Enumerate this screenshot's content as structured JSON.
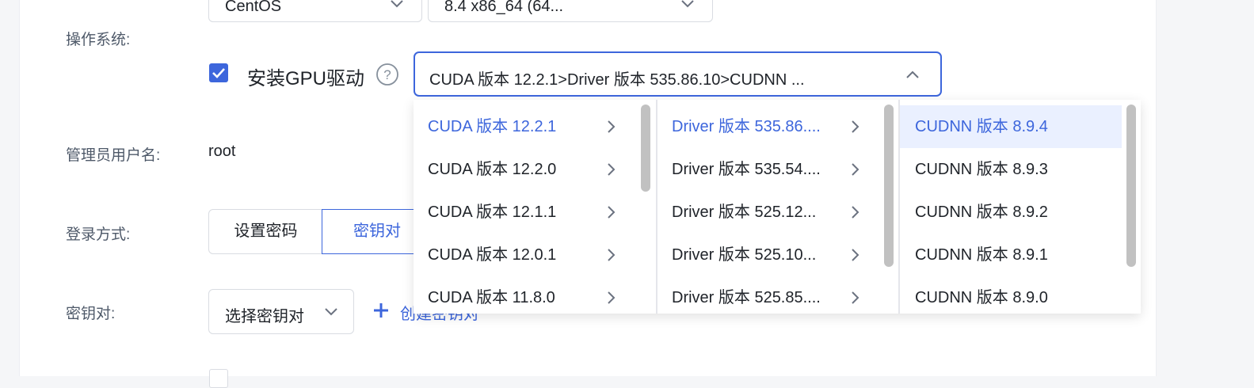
{
  "form": {
    "os_label": "操作系统:",
    "os_select": "CentOS",
    "os_version_select": "8.4 x86_64 (64...",
    "gpu_checkbox_checked": true,
    "gpu_label": "安装GPU驱动",
    "gpu_select_value": "CUDA 版本 12.2.1>Driver 版本 535.86.10>CUDNN ...",
    "admin_label": "管理员用户名:",
    "admin_value": "root",
    "login_label": "登录方式:",
    "login_option_password": "设置密码",
    "login_option_keypair": "密钥对",
    "keypair_label": "密钥对:",
    "keypair_select": "选择密钥对",
    "create_keypair": "创建密钥对"
  },
  "cascader": {
    "cuda_options": [
      "CUDA 版本 12.2.1",
      "CUDA 版本 12.2.0",
      "CUDA 版本 12.1.1",
      "CUDA 版本 12.0.1",
      "CUDA 版本 11.8.0"
    ],
    "driver_options": [
      "Driver 版本 535.86....",
      "Driver 版本 535.54....",
      "Driver 版本 525.12...",
      "Driver 版本 525.10...",
      "Driver 版本 525.85...."
    ],
    "cudnn_options": [
      "CUDNN 版本 8.9.4",
      "CUDNN 版本 8.9.3",
      "CUDNN 版本 8.9.2",
      "CUDNN 版本 8.9.1",
      "CUDNN 版本 8.9.0"
    ]
  },
  "colors": {
    "accent": "#3d66dc",
    "selected_bg": "#eaf0ff",
    "label": "#4e5969"
  },
  "icons": [
    "chevron-down-icon",
    "chevron-up-icon",
    "help-icon",
    "check-icon",
    "chevron-right-icon",
    "plus-icon"
  ]
}
